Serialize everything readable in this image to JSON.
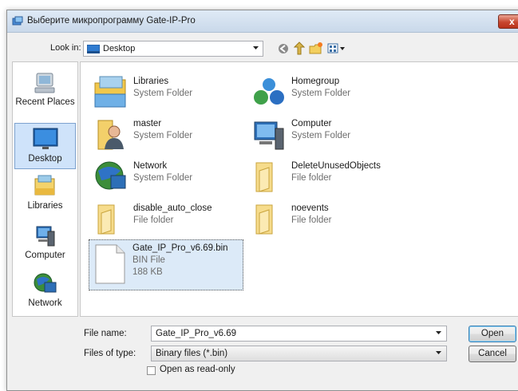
{
  "window": {
    "title": "Выберите микропрограмму Gate-IP-Pro",
    "close_label": "x"
  },
  "toolbar": {
    "look_in_label": "Look in:",
    "look_in_value": "Desktop",
    "icons": [
      "back-icon",
      "up-folder-icon",
      "new-folder-icon",
      "view-menu-icon"
    ]
  },
  "places": [
    {
      "label": "Recent Places",
      "icon": "recent-places-icon"
    },
    {
      "label": "Desktop",
      "icon": "desktop-icon",
      "selected": true
    },
    {
      "label": "Libraries",
      "icon": "libraries-icon"
    },
    {
      "label": "Computer",
      "icon": "computer-icon"
    },
    {
      "label": "Network",
      "icon": "network-icon"
    }
  ],
  "files": [
    {
      "name": "Libraries",
      "type": "System Folder",
      "icon": "libraries-folder-icon"
    },
    {
      "name": "Homegroup",
      "type": "System Folder",
      "icon": "homegroup-icon"
    },
    {
      "name": "master",
      "type": "System Folder",
      "icon": "user-folder-icon"
    },
    {
      "name": "Computer",
      "type": "System Folder",
      "icon": "computer-icon"
    },
    {
      "name": "Network",
      "type": "System Folder",
      "icon": "network-icon"
    },
    {
      "name": "DeleteUnusedObjects",
      "type": "File folder",
      "icon": "folder-icon"
    },
    {
      "name": "disable_auto_close",
      "type": "File folder",
      "icon": "folder-icon"
    },
    {
      "name": "noevents",
      "type": "File folder",
      "icon": "folder-icon"
    },
    {
      "name": "Gate_IP_Pro_v6.69.bin",
      "type": "BIN File",
      "size": "188 KB",
      "icon": "file-icon",
      "selected": true
    }
  ],
  "footer": {
    "file_name_label": "File name:",
    "file_name_value": "Gate_IP_Pro_v6.69",
    "file_type_label": "Files of type:",
    "file_type_value": "Binary files (*.bin)",
    "readonly_label": "Open as read-only",
    "readonly_checked": false,
    "open_label": "Open",
    "cancel_label": "Cancel"
  },
  "colors": {
    "titlebar": "#c9d8ea",
    "selection": "#cfe3fa",
    "close_button": "#c8462f"
  }
}
